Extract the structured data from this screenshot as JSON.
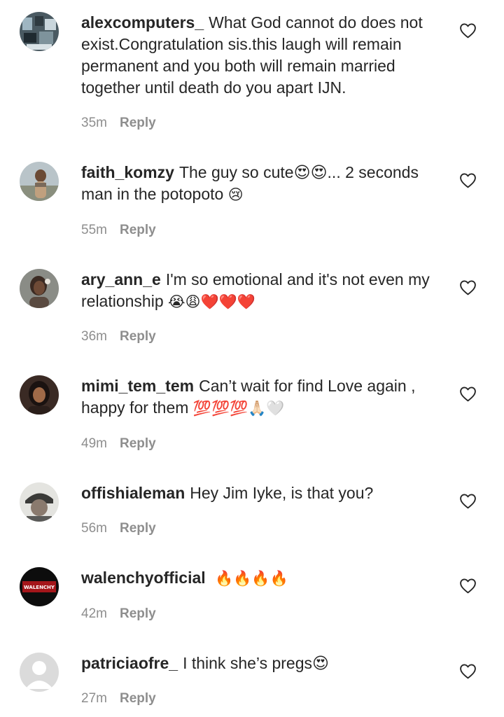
{
  "comments": [
    {
      "username": "alexcomputers_",
      "text": "What God cannot do does not exist.Congratulation sis.this laugh will remain permanent and you both will remain married together until death do you apart IJN.",
      "emojis": "",
      "time": "35m",
      "reply_label": "Reply",
      "avatar_icon": "photo-avatar"
    },
    {
      "username": "faith_komzy",
      "text": "The guy so cute😍😍... 2 seconds man in the potopoto",
      "emojis": "😢",
      "time": "55m",
      "reply_label": "Reply",
      "avatar_icon": "photo-avatar"
    },
    {
      "username": "ary_ann_e",
      "text": "I'm so emotional and it's not even my relationship",
      "emojis": "😭😩❤️❤️❤️",
      "time": "36m",
      "reply_label": "Reply",
      "avatar_icon": "photo-avatar"
    },
    {
      "username": "mimi_tem_tem",
      "text": "Can’t wait for find Love again , happy for them",
      "emojis": "💯💯💯🙏🏻🤍",
      "time": "49m",
      "reply_label": "Reply",
      "avatar_icon": "photo-avatar"
    },
    {
      "username": "offishialeman",
      "text": "Hey Jim Iyke, is that you?",
      "emojis": "",
      "time": "56m",
      "reply_label": "Reply",
      "avatar_icon": "photo-avatar"
    },
    {
      "username": "walenchyofficial",
      "text": "",
      "emojis": "🔥🔥🔥🔥",
      "time": "42m",
      "reply_label": "Reply",
      "avatar_icon": "brand-logo-avatar",
      "avatar_text": "WALENCHY"
    },
    {
      "username": "patriciaofre_",
      "text": "I think she’s pregs😍",
      "emojis": "",
      "time": "27m",
      "reply_label": "Reply",
      "avatar_icon": "default-user-avatar"
    }
  ],
  "colors": {
    "text": "#262626",
    "secondary": "#8e8e8e",
    "background": "#ffffff"
  },
  "icons": {
    "like": "heart-outline-icon"
  }
}
